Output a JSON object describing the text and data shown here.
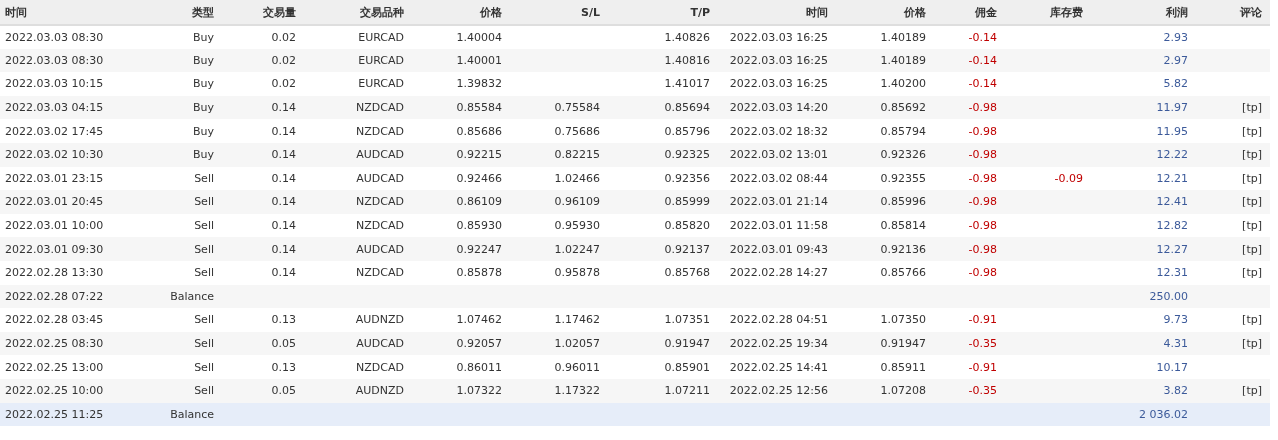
{
  "table": {
    "columns": [
      "时间",
      "类型",
      "交易量",
      "交易品种",
      "价格",
      "S/L",
      "T/P",
      "时间",
      "价格",
      "佣金",
      "库存费",
      "利润",
      "评论"
    ],
    "rows": [
      {
        "kind": "trade",
        "selected": false,
        "open_time": "2022.03.03 08:30",
        "type": "Buy",
        "volume": "0.02",
        "symbol": "EURCAD",
        "open_price": "1.40004",
        "tp": "1.40826",
        "close_time": "2022.03.03 16:25",
        "close_price": "1.40189",
        "commission": "-0.14",
        "profit": "2.93"
      },
      {
        "kind": "trade",
        "selected": false,
        "open_time": "2022.03.03 08:30",
        "type": "Buy",
        "volume": "0.02",
        "symbol": "EURCAD",
        "open_price": "1.40001",
        "tp": "1.40816",
        "close_time": "2022.03.03 16:25",
        "close_price": "1.40189",
        "commission": "-0.14",
        "profit": "2.97"
      },
      {
        "kind": "trade",
        "selected": false,
        "open_time": "2022.03.03 10:15",
        "type": "Buy",
        "volume": "0.02",
        "symbol": "EURCAD",
        "open_price": "1.39832",
        "tp": "1.41017",
        "close_time": "2022.03.03 16:25",
        "close_price": "1.40200",
        "commission": "-0.14",
        "profit": "5.82"
      },
      {
        "kind": "trade",
        "selected": false,
        "open_time": "2022.03.03 04:15",
        "type": "Buy",
        "volume": "0.14",
        "symbol": "NZDCAD",
        "open_price": "0.85584",
        "sl": "0.75584",
        "tp": "0.85694",
        "close_time": "2022.03.03 14:20",
        "close_price": "0.85692",
        "commission": "-0.98",
        "profit": "11.97",
        "comment": "[tp]"
      },
      {
        "kind": "trade",
        "selected": false,
        "open_time": "2022.03.02 17:45",
        "type": "Buy",
        "volume": "0.14",
        "symbol": "NZDCAD",
        "open_price": "0.85686",
        "sl": "0.75686",
        "tp": "0.85796",
        "close_time": "2022.03.02 18:32",
        "close_price": "0.85794",
        "commission": "-0.98",
        "profit": "11.95",
        "comment": "[tp]"
      },
      {
        "kind": "trade",
        "selected": false,
        "open_time": "2022.03.02 10:30",
        "type": "Buy",
        "volume": "0.14",
        "symbol": "AUDCAD",
        "open_price": "0.92215",
        "sl": "0.82215",
        "tp": "0.92325",
        "close_time": "2022.03.02 13:01",
        "close_price": "0.92326",
        "commission": "-0.98",
        "profit": "12.22",
        "comment": "[tp]"
      },
      {
        "kind": "trade",
        "selected": false,
        "open_time": "2022.03.01 23:15",
        "type": "Sell",
        "volume": "0.14",
        "symbol": "AUDCAD",
        "open_price": "0.92466",
        "sl": "1.02466",
        "tp": "0.92356",
        "close_time": "2022.03.02 08:44",
        "close_price": "0.92355",
        "commission": "-0.98",
        "swap": "-0.09",
        "profit": "12.21",
        "comment": "[tp]"
      },
      {
        "kind": "trade",
        "selected": false,
        "open_time": "2022.03.01 20:45",
        "type": "Sell",
        "volume": "0.14",
        "symbol": "NZDCAD",
        "open_price": "0.86109",
        "sl": "0.96109",
        "tp": "0.85999",
        "close_time": "2022.03.01 21:14",
        "close_price": "0.85996",
        "commission": "-0.98",
        "profit": "12.41",
        "comment": "[tp]"
      },
      {
        "kind": "trade",
        "selected": false,
        "open_time": "2022.03.01 10:00",
        "type": "Sell",
        "volume": "0.14",
        "symbol": "NZDCAD",
        "open_price": "0.85930",
        "sl": "0.95930",
        "tp": "0.85820",
        "close_time": "2022.03.01 11:58",
        "close_price": "0.85814",
        "commission": "-0.98",
        "profit": "12.82",
        "comment": "[tp]"
      },
      {
        "kind": "trade",
        "selected": false,
        "open_time": "2022.03.01 09:30",
        "type": "Sell",
        "volume": "0.14",
        "symbol": "AUDCAD",
        "open_price": "0.92247",
        "sl": "1.02247",
        "tp": "0.92137",
        "close_time": "2022.03.01 09:43",
        "close_price": "0.92136",
        "commission": "-0.98",
        "profit": "12.27",
        "comment": "[tp]"
      },
      {
        "kind": "trade",
        "selected": false,
        "open_time": "2022.02.28 13:30",
        "type": "Sell",
        "volume": "0.14",
        "symbol": "NZDCAD",
        "open_price": "0.85878",
        "sl": "0.95878",
        "tp": "0.85768",
        "close_time": "2022.02.28 14:27",
        "close_price": "0.85766",
        "commission": "-0.98",
        "profit": "12.31",
        "comment": "[tp]"
      },
      {
        "kind": "balance",
        "selected": false,
        "open_time": "2022.02.28 07:22",
        "type": "Balance",
        "profit": "250.00"
      },
      {
        "kind": "trade",
        "selected": false,
        "open_time": "2022.02.28 03:45",
        "type": "Sell",
        "volume": "0.13",
        "symbol": "AUDNZD",
        "open_price": "1.07462",
        "sl": "1.17462",
        "tp": "1.07351",
        "close_time": "2022.02.28 04:51",
        "close_price": "1.07350",
        "commission": "-0.91",
        "profit": "9.73",
        "comment": "[tp]"
      },
      {
        "kind": "trade",
        "selected": false,
        "open_time": "2022.02.25 08:30",
        "type": "Sell",
        "volume": "0.05",
        "symbol": "AUDCAD",
        "open_price": "0.92057",
        "sl": "1.02057",
        "tp": "0.91947",
        "close_time": "2022.02.25 19:34",
        "close_price": "0.91947",
        "commission": "-0.35",
        "profit": "4.31",
        "comment": "[tp]"
      },
      {
        "kind": "trade",
        "selected": false,
        "open_time": "2022.02.25 13:00",
        "type": "Sell",
        "volume": "0.13",
        "symbol": "NZDCAD",
        "open_price": "0.86011",
        "sl": "0.96011",
        "tp": "0.85901",
        "close_time": "2022.02.25 14:41",
        "close_price": "0.85911",
        "commission": "-0.91",
        "profit": "10.17"
      },
      {
        "kind": "trade",
        "selected": false,
        "open_time": "2022.02.25 10:00",
        "type": "Sell",
        "volume": "0.05",
        "symbol": "AUDNZD",
        "open_price": "1.07322",
        "sl": "1.17322",
        "tp": "1.07211",
        "close_time": "2022.02.25 12:56",
        "close_price": "1.07208",
        "commission": "-0.35",
        "profit": "3.82",
        "comment": "[tp]"
      },
      {
        "kind": "balance",
        "selected": true,
        "open_time": "2022.02.25 11:25",
        "type": "Balance",
        "profit": "2 036.02"
      }
    ]
  }
}
